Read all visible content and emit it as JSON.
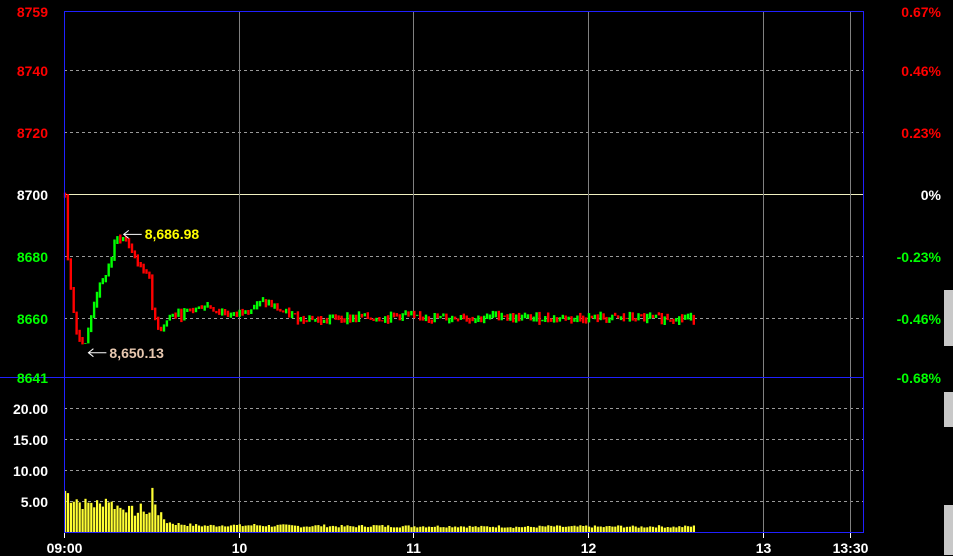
{
  "chart_data": {
    "type": "line",
    "subtype": "intraday price bars with volume",
    "x_axis": {
      "ticks": [
        "09:00",
        "10",
        "11",
        "12",
        "13",
        "13:30"
      ]
    },
    "price_axis_left": {
      "range": [
        8641,
        8759
      ],
      "ticks": [
        {
          "value": 8759,
          "label": "8759",
          "color": "#ff0000"
        },
        {
          "value": 8740,
          "label": "8740",
          "color": "#ff0000"
        },
        {
          "value": 8720,
          "label": "8720",
          "color": "#ff0000"
        },
        {
          "value": 8700,
          "label": "8700",
          "color": "#ffffff"
        },
        {
          "value": 8680,
          "label": "8680",
          "color": "#00ff00"
        },
        {
          "value": 8660,
          "label": "8660",
          "color": "#00ff00"
        },
        {
          "value": 8641,
          "label": "8641",
          "color": "#00ff00"
        }
      ]
    },
    "percent_axis_right": {
      "ticks": [
        {
          "value": 8759,
          "label": "0.67%",
          "color": "#ff0000"
        },
        {
          "value": 8740,
          "label": "0.46%",
          "color": "#ff0000"
        },
        {
          "value": 8720,
          "label": "0.23%",
          "color": "#ff0000"
        },
        {
          "value": 8700,
          "label": "0%",
          "color": "#ffffff"
        },
        {
          "value": 8680,
          "label": "-0.23%",
          "color": "#00ff00"
        },
        {
          "value": 8660,
          "label": "-0.46%",
          "color": "#00ff00"
        },
        {
          "value": 8641,
          "label": "-0.68%",
          "color": "#00ff00"
        }
      ]
    },
    "volume_axis": {
      "range": [
        0,
        25
      ],
      "ticks": [
        {
          "value": 20,
          "label": "20.00"
        },
        {
          "value": 15,
          "label": "15.00"
        },
        {
          "value": 10,
          "label": "10.00"
        },
        {
          "value": 5,
          "label": "5.00"
        }
      ]
    },
    "reference_price": 8700,
    "annotations": [
      {
        "label": "8,686.98",
        "value": 8686.98,
        "color": "#ffff00"
      },
      {
        "label": "8,650.13",
        "value": 8650.13,
        "color": "#e8c8b0"
      }
    ],
    "colors": {
      "up": "#00ff00",
      "down": "#ff0000",
      "volume": "#ffff33",
      "frame": "#2020ff",
      "reference_line": "#f0f0c0"
    },
    "price_path": [
      [
        0,
        8700
      ],
      [
        1,
        8683
      ],
      [
        5,
        8674
      ],
      [
        10,
        8662
      ],
      [
        13,
        8657
      ],
      [
        15,
        8653
      ],
      [
        18,
        8654
      ],
      [
        22,
        8651
      ],
      [
        27,
        8656
      ],
      [
        30,
        8661
      ],
      [
        33,
        8665
      ],
      [
        37,
        8669
      ],
      [
        42,
        8671
      ],
      [
        47,
        8675
      ],
      [
        51,
        8677
      ],
      [
        55,
        8683
      ],
      [
        60,
        8686
      ],
      [
        64,
        8686
      ],
      [
        68,
        8685
      ],
      [
        72,
        8684
      ],
      [
        77,
        8681
      ],
      [
        82,
        8678
      ],
      [
        87,
        8676
      ],
      [
        92,
        8675
      ],
      [
        96,
        8674
      ],
      [
        98,
        8663
      ],
      [
        102,
        8660
      ],
      [
        106,
        8657
      ],
      [
        110,
        8657
      ],
      [
        115,
        8659
      ],
      [
        120,
        8661
      ],
      [
        126,
        8661
      ],
      [
        132,
        8661
      ],
      [
        138,
        8662
      ],
      [
        144,
        8663
      ],
      [
        150,
        8663
      ],
      [
        156,
        8664
      ],
      [
        162,
        8664
      ],
      [
        168,
        8663
      ],
      [
        174,
        8662
      ],
      [
        180,
        8662
      ],
      [
        186,
        8661
      ],
      [
        192,
        8661
      ],
      [
        198,
        8662
      ],
      [
        204,
        8663
      ],
      [
        210,
        8663
      ],
      [
        216,
        8664
      ],
      [
        222,
        8665
      ],
      [
        228,
        8665
      ],
      [
        234,
        8664
      ],
      [
        240,
        8663
      ],
      [
        246,
        8662
      ],
      [
        252,
        8661
      ],
      [
        258,
        8661
      ],
      [
        264,
        8660
      ],
      [
        270,
        8660
      ],
      [
        276,
        8660
      ],
      [
        282,
        8660
      ],
      [
        288,
        8659
      ],
      [
        294,
        8659
      ],
      [
        300,
        8660
      ],
      [
        306,
        8660
      ],
      [
        312,
        8660
      ],
      [
        318,
        8660
      ],
      [
        324,
        8660
      ],
      [
        330,
        8660
      ],
      [
        336,
        8661
      ],
      [
        342,
        8660
      ],
      [
        348,
        8660
      ],
      [
        354,
        8660
      ],
      [
        360,
        8660
      ],
      [
        366,
        8660
      ],
      [
        372,
        8661
      ],
      [
        378,
        8661
      ],
      [
        384,
        8661
      ],
      [
        390,
        8661
      ],
      [
        396,
        8660
      ],
      [
        402,
        8660
      ],
      [
        408,
        8661
      ],
      [
        414,
        8660
      ],
      [
        420,
        8660
      ],
      [
        426,
        8660
      ],
      [
        432,
        8660
      ],
      [
        438,
        8660
      ],
      [
        444,
        8660
      ],
      [
        450,
        8661
      ],
      [
        456,
        8660
      ],
      [
        462,
        8660
      ],
      [
        468,
        8660
      ],
      [
        474,
        8660
      ],
      [
        480,
        8660
      ],
      [
        486,
        8661
      ],
      [
        492,
        8661
      ],
      [
        498,
        8661
      ],
      [
        504,
        8660
      ],
      [
        510,
        8660
      ],
      [
        516,
        8660
      ],
      [
        522,
        8660
      ],
      [
        528,
        8660
      ],
      [
        534,
        8660
      ],
      [
        540,
        8660
      ],
      [
        546,
        8660
      ],
      [
        552,
        8660
      ],
      [
        558,
        8660
      ],
      [
        564,
        8660
      ],
      [
        570,
        8660
      ],
      [
        576,
        8660
      ],
      [
        582,
        8660
      ],
      [
        588,
        8660
      ],
      [
        594,
        8660
      ],
      [
        600,
        8660
      ],
      [
        606,
        8660
      ],
      [
        612,
        8660
      ],
      [
        618,
        8660
      ],
      [
        624,
        8660
      ],
      [
        630,
        8660
      ],
      [
        636,
        8660
      ],
      [
        642,
        8660
      ],
      [
        648,
        8660
      ],
      [
        654,
        8660
      ],
      [
        660,
        8660
      ],
      [
        666,
        8660
      ],
      [
        672,
        8660
      ],
      [
        678,
        8660
      ],
      [
        684,
        8660
      ],
      [
        690,
        8660
      ],
      [
        696,
        8660
      ],
      [
        702,
        8660
      ],
      [
        708,
        8660
      ],
      [
        714,
        8660
      ]
    ],
    "volume_path": [
      [
        0,
        6.5
      ],
      [
        3,
        6.0
      ],
      [
        6,
        5.6
      ],
      [
        9,
        5.2
      ],
      [
        12,
        5.8
      ],
      [
        15,
        4.5
      ],
      [
        18,
        4.8
      ],
      [
        21,
        4.2
      ],
      [
        24,
        4.6
      ],
      [
        27,
        4.4
      ],
      [
        30,
        4.8
      ],
      [
        33,
        4.3
      ],
      [
        36,
        4.5
      ],
      [
        39,
        4.0
      ],
      [
        42,
        5.0
      ],
      [
        45,
        4.7
      ],
      [
        48,
        6.0
      ],
      [
        51,
        4.5
      ],
      [
        54,
        4.4
      ],
      [
        57,
        4.2
      ],
      [
        60,
        4.0
      ],
      [
        63,
        3.8
      ],
      [
        66,
        4.1
      ],
      [
        69,
        3.9
      ],
      [
        72,
        3.4
      ],
      [
        75,
        3.6
      ],
      [
        78,
        3.0
      ],
      [
        81,
        3.2
      ],
      [
        84,
        3.0
      ],
      [
        87,
        4.2
      ],
      [
        90,
        3.5
      ],
      [
        93,
        2.8
      ],
      [
        96,
        3.0
      ],
      [
        98,
        4.5
      ],
      [
        100,
        8.4
      ],
      [
        103,
        3.7
      ],
      [
        106,
        3.0
      ],
      [
        110,
        2.4
      ],
      [
        115,
        1.6
      ],
      [
        125,
        1.3
      ],
      [
        135,
        1.2
      ],
      [
        145,
        1.1
      ],
      [
        155,
        1.0
      ],
      [
        170,
        1.0
      ],
      [
        185,
        1.1
      ],
      [
        200,
        1.0
      ],
      [
        215,
        1.1
      ],
      [
        230,
        1.0
      ],
      [
        250,
        1.0
      ],
      [
        270,
        0.9
      ],
      [
        290,
        1.0
      ],
      [
        310,
        0.9
      ],
      [
        330,
        0.9
      ],
      [
        350,
        1.0
      ],
      [
        370,
        0.9
      ],
      [
        390,
        0.9
      ],
      [
        410,
        0.9
      ],
      [
        430,
        0.9
      ],
      [
        450,
        0.9
      ],
      [
        470,
        0.8
      ],
      [
        490,
        0.9
      ],
      [
        510,
        0.8
      ],
      [
        530,
        0.8
      ],
      [
        550,
        0.9
      ],
      [
        570,
        0.8
      ],
      [
        590,
        0.9
      ],
      [
        610,
        0.8
      ],
      [
        630,
        0.9
      ],
      [
        650,
        0.8
      ],
      [
        670,
        0.9
      ],
      [
        690,
        0.8
      ],
      [
        714,
        0.9
      ]
    ]
  }
}
